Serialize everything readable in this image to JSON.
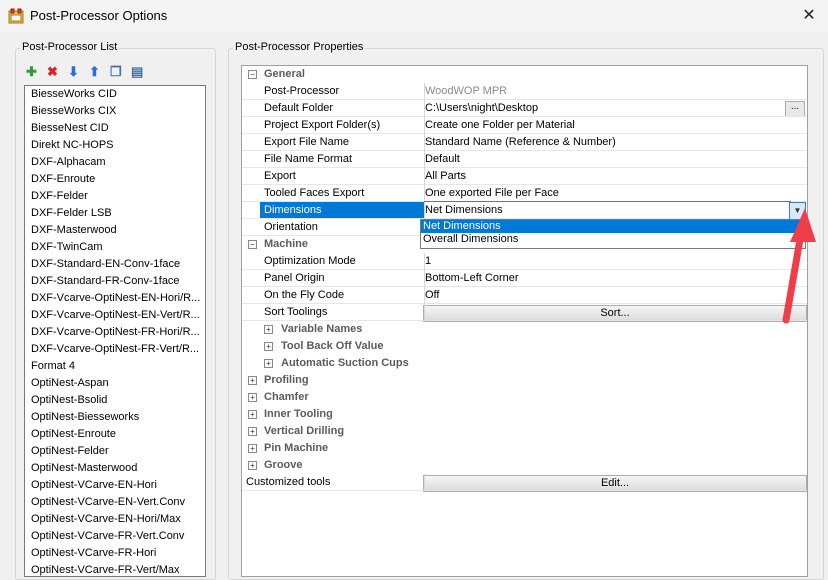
{
  "window": {
    "title": "Post-Processor Options",
    "close_glyph": "✕"
  },
  "left_panel": {
    "title": "Post-Processor List",
    "toolbar": [
      {
        "name": "add-icon",
        "glyph": "✚",
        "color": "#2e9e2e"
      },
      {
        "name": "delete-icon",
        "glyph": "✖",
        "color": "#d22"
      },
      {
        "name": "move-down-icon",
        "glyph": "⬇",
        "color": "#2a6ed6"
      },
      {
        "name": "move-up-icon",
        "glyph": "⬆",
        "color": "#2a6ed6"
      },
      {
        "name": "copy-icon",
        "glyph": "❐",
        "color": "#3d6fb0"
      },
      {
        "name": "rename-icon",
        "glyph": "▤",
        "color": "#3d6fb0"
      }
    ],
    "items": [
      "BiesseWorks CID",
      "BiesseWorks CIX",
      "BiesseNest CID",
      "Direkt NC-HOPS",
      "DXF-Alphacam",
      "DXF-Enroute",
      "DXF-Felder",
      "DXF-Felder LSB",
      "DXF-Masterwood",
      "DXF-TwinCam",
      "DXF-Standard-EN-Conv-1face",
      "DXF-Standard-FR-Conv-1face",
      "DXF-Vcarve-OptiNest-EN-Hori/R...",
      "DXF-Vcarve-OptiNest-EN-Vert/R...",
      "DXF-Vcarve-OptiNest-FR-Hori/R...",
      "DXF-Vcarve-OptiNest-FR-Vert/R...",
      "Format 4",
      "OptiNest-Aspan",
      "OptiNest-Bsolid",
      "OptiNest-Biesseworks",
      "OptiNest-Enroute",
      "OptiNest-Felder",
      "OptiNest-Masterwood",
      "OptiNest-VCarve-EN-Hori",
      "OptiNest-VCarve-EN-Vert.Conv",
      "OptiNest-VCarve-EN-Hori/Max",
      "OptiNest-VCarve-FR-Vert.Conv",
      "OptiNest-VCarve-FR-Hori",
      "OptiNest-VCarve-FR-Vert/Max"
    ]
  },
  "right_panel": {
    "title": "Post-Processor Properties",
    "general": {
      "label": "General",
      "rows": [
        {
          "name": "Post-Processor",
          "value": "WoodWOP MPR",
          "muted": true
        },
        {
          "name": "Default Folder",
          "value": "C:\\Users\\night\\Desktop",
          "dots": "..."
        },
        {
          "name": "Project Export Folder(s)",
          "value": "Create one Folder per Material"
        },
        {
          "name": "Export File Name",
          "value": "Standard Name (Reference & Number)"
        },
        {
          "name": "File Name Format",
          "value": "Default"
        },
        {
          "name": "Export",
          "value": "All Parts"
        },
        {
          "name": "Tooled Faces Export",
          "value": "One exported File per Face"
        },
        {
          "name": "Dimensions",
          "value": "Net Dimensions",
          "selected": true
        },
        {
          "name": "Orientation",
          "value": ""
        }
      ]
    },
    "dimensions_dropdown": {
      "options": [
        "Net Dimensions",
        "Overall Dimensions"
      ],
      "selected_index": 0
    },
    "machine": {
      "label": "Machine",
      "rows": [
        {
          "name": "Optimization Mode",
          "value": "1"
        },
        {
          "name": "Panel Origin",
          "value": "Bottom-Left Corner"
        },
        {
          "name": "On the Fly Code",
          "value": "Off"
        },
        {
          "name": "Sort Toolings",
          "button": "Sort..."
        }
      ],
      "subgroups": [
        "Variable Names",
        "Tool Back Off Value",
        "Automatic Suction Cups"
      ]
    },
    "categories": [
      "Profiling",
      "Chamfer",
      "Inner Tooling",
      "Vertical Drilling",
      "Pin Machine",
      "Groove"
    ],
    "customized": {
      "name": "Customized tools",
      "button": "Edit..."
    },
    "expander_open": "−",
    "expander_closed": "+"
  },
  "colors": {
    "selection": "#0078d7",
    "arrow": "#ef3d4a"
  }
}
